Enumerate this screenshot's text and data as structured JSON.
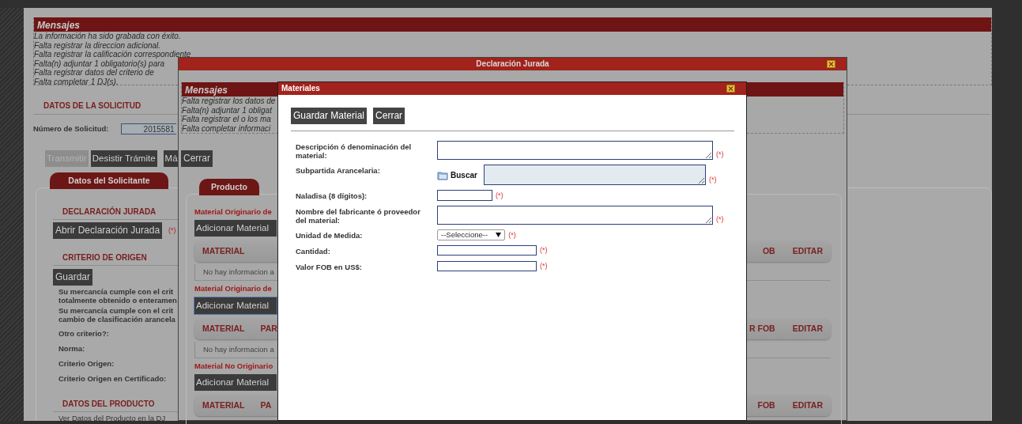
{
  "background_page": {
    "messages": {
      "title": "Mensajes",
      "lines": [
        "La información ha sido grabada con éxito.",
        "Falta registrar la direccion adicional.",
        "Falta registrar la calificación correspondiente",
        "Falta(n) adjuntar 1 obligatorio(s) para",
        "Falta registrar datos del criterio de",
        "Falta completar 1 DJ(s)."
      ]
    },
    "request": {
      "heading": "DATOS DE LA SOLICITUD",
      "number_label": "Número de Solicitud:",
      "number_value": "2015581"
    },
    "actions": [
      {
        "label": "Transmitir",
        "disabled": true
      },
      {
        "label": "Desistir Trámite",
        "disabled": false
      },
      {
        "label": "Má",
        "disabled": false
      }
    ],
    "tab": "Datos del Solicitante",
    "declaration": {
      "heading": "DECLARACIÓN JURADA",
      "button": "Abrir Declaración Jurada",
      "required": "(*)"
    },
    "origin": {
      "heading": "CRITERIO DE ORIGEN",
      "button": "Guardar",
      "criteria": [
        [
          "Su mercancía cumple con el crit",
          "totalmente obtenido o enteramen"
        ],
        [
          "Su mercancía cumple con el crit",
          "cambio de clasificación arancela"
        ]
      ],
      "fields": [
        "Otro criterio?:",
        "Norma:",
        "Criterio Origen:",
        "Criterio Origen en Certificado:"
      ]
    },
    "product": {
      "heading": "DATOS DEL PRODUCTO",
      "link": "Ver Datos del Producto en la DJ"
    }
  },
  "declaration_dialog": {
    "title": "Declaración Jurada",
    "messages": {
      "title": "Mensajes",
      "lines": [
        "Falta registrar los datos de",
        "Falta(n) adjuntar 1 obligat",
        "Falta registrar el o los ma",
        "Falta completar informaci"
      ]
    },
    "close_button": "Cerrar",
    "tab": "Producto",
    "sections": [
      {
        "label": "Material Originario de",
        "add_button": "Adicionar Material",
        "focused": false,
        "columns_left": [
          "MATERIAL"
        ],
        "columns_right": [
          "OB",
          "EDITAR"
        ],
        "empty_text": "No hay informacion a"
      },
      {
        "label": "Material Originario de",
        "add_button": "Adicionar Material",
        "focused": true,
        "columns_left": [
          "MATERIAL",
          "PAR"
        ],
        "columns_right": [
          "R FOB",
          "EDITAR"
        ],
        "empty_text": "No hay informacion a"
      },
      {
        "label": "Material No Originario",
        "add_button": "Adicionar Material",
        "focused": false,
        "columns_left": [
          "MATERIAL",
          "PA"
        ],
        "columns_right": [
          "FOB",
          "EDITAR"
        ]
      }
    ]
  },
  "materials_dialog": {
    "title": "Materiales",
    "buttons": [
      "Guardar Material",
      "Cerrar"
    ],
    "fields": [
      {
        "kind": "textarea",
        "label": "Descripción ó denominación del material:",
        "required": "(*)"
      },
      {
        "kind": "search",
        "label": "Subpartida Arancelaria:",
        "search_label": "Buscar",
        "required": "(*)"
      },
      {
        "kind": "short",
        "label": "Naladisa (8 dígitos):",
        "required": "(*)"
      },
      {
        "kind": "textarea",
        "label": "Nombre del fabricante ó proveedor del material:",
        "required": "(*)"
      },
      {
        "kind": "select",
        "label": "Unidad de Medida:",
        "value": "--Seleccione--",
        "required": "(*)"
      },
      {
        "kind": "input",
        "label": "Cantidad:",
        "required": "(*)"
      },
      {
        "kind": "input",
        "label": "Valor FOB en US$:",
        "required": "(*)"
      }
    ]
  }
}
